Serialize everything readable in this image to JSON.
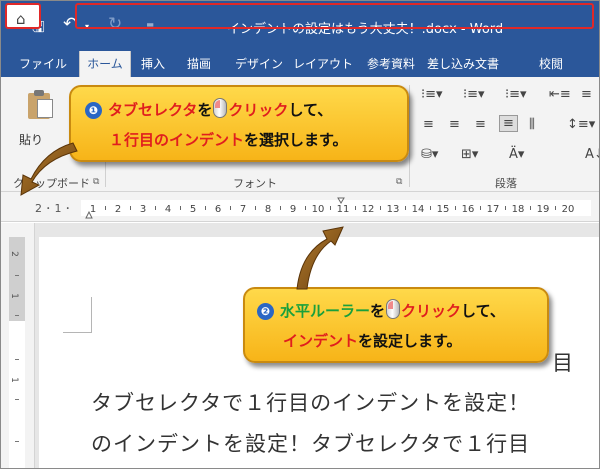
{
  "window": {
    "title": "インデントの設定はもう大丈夫！.docx  -  Word"
  },
  "quick_access": {
    "save_icon": "save-icon",
    "undo_icon": "undo-icon",
    "redo_icon": "redo-icon",
    "customize_icon": "customize-quick-access-icon"
  },
  "tabs": [
    {
      "label": "ファイル"
    },
    {
      "label": "ホーム"
    },
    {
      "label": "挿入"
    },
    {
      "label": "描画"
    },
    {
      "label": "デザイン"
    },
    {
      "label": "レイアウト"
    },
    {
      "label": "参考資料"
    },
    {
      "label": "差し込み文書"
    },
    {
      "label": "校閲"
    }
  ],
  "active_tab": "ホーム",
  "ribbon": {
    "paste_label": "貼り",
    "clipboard_label": "クリップボード",
    "font_label": "フォント",
    "paragraph_label": "段落"
  },
  "ruler": {
    "left_numbers": "2 ･ 1 ･",
    "numbers": [
      "1",
      "2",
      "3",
      "4",
      "5",
      "6",
      "7",
      "8",
      "9",
      "10",
      "11",
      "12",
      "13",
      "14",
      "15",
      "16",
      "17",
      "18",
      "19",
      "20"
    ],
    "vertical_numbers": [
      "2",
      "1",
      "1"
    ]
  },
  "callout1": {
    "number": "❶",
    "line1_a": "タブセレクタ",
    "line1_b": "を",
    "line1_c": "クリック",
    "line1_d": "して、",
    "line2_a": "１行目のインデント",
    "line2_b": "を選択します。"
  },
  "callout2": {
    "number": "❷",
    "line1_a": "水平ルーラー",
    "line1_b": "を",
    "line1_c": "クリック",
    "line1_d": "して、",
    "line2_a": "インデント",
    "line2_b": "を設定します。"
  },
  "document": {
    "line1_tail": "目",
    "line2": "タブセレクタで１行目のインデントを設定！",
    "line3": "のインデントを設定！タブセレクタで１行目"
  },
  "colors": {
    "word_blue": "#2b579a",
    "highlight_red": "#e02828",
    "callout_yellow": "#f7b418",
    "arrow_brown": "#8a5a1a"
  }
}
